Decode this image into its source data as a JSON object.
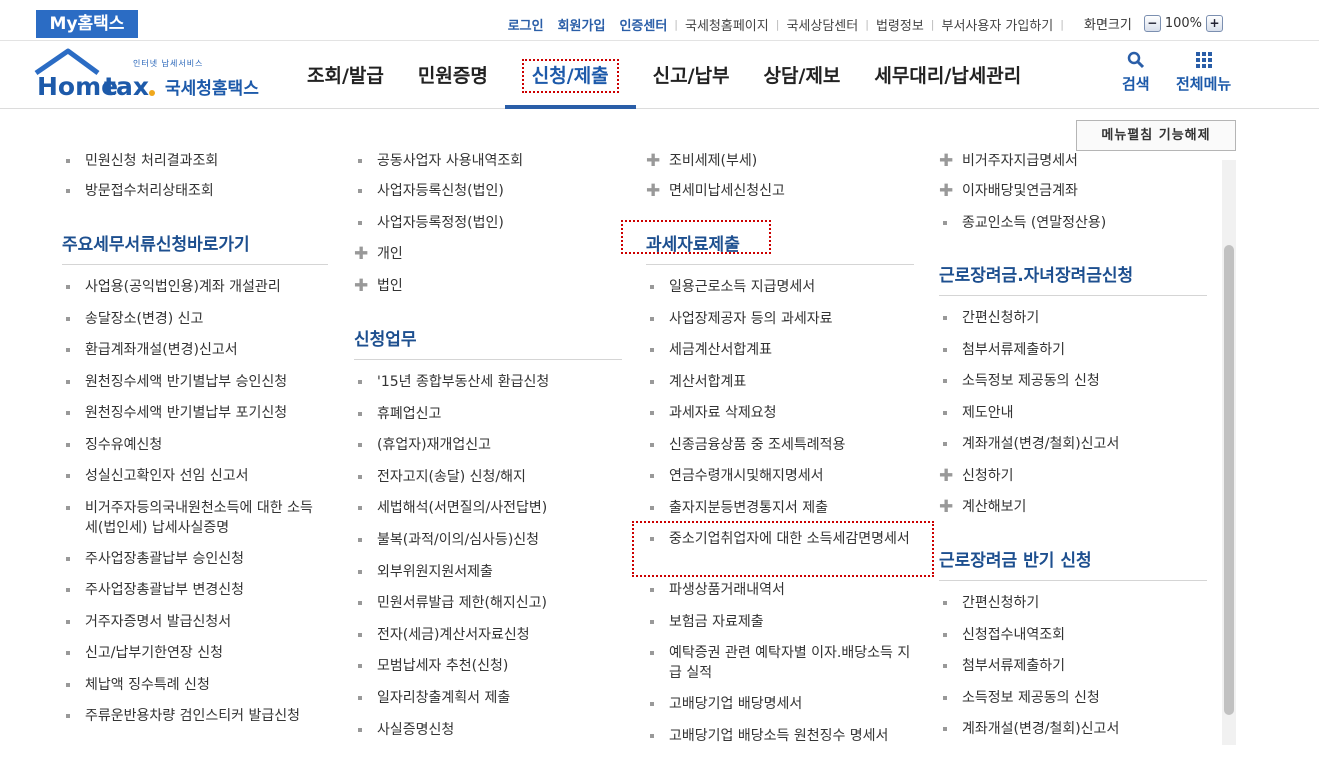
{
  "topbar": {
    "brand": "My홈택스",
    "links": [
      "로그인",
      "회원가입",
      "인증센터"
    ],
    "plain_links": [
      "국세청홈페이지",
      "국세상담센터",
      "법령정보",
      "부서사용자 가입하기"
    ],
    "zoom_label": "화면크기",
    "zoom_value": "100%",
    "zoom_minus": "−",
    "zoom_plus": "+"
  },
  "header": {
    "logo_sub": "인터넷 납세서비스",
    "logo_en": "Hometax.",
    "logo_ko": "국세청홈택스",
    "nav": [
      "조회/발급",
      "민원증명",
      "신청/제출",
      "신고/납부",
      "상담/제보",
      "세무대리/납세관리"
    ],
    "active_nav_index": 2,
    "search_label": "검색",
    "allmenu_label": "전체메뉴"
  },
  "expand_button": "메뉴펼침 기능해제",
  "col1": {
    "top_items": [
      "민원신청 처리결과조회",
      "방문접수처리상태조회"
    ],
    "section_title": "주요세무서류신청바로가기",
    "items": [
      "사업용(공익법인용)계좌 개설관리",
      "송달장소(변경) 신고",
      "환급계좌개설(변경)신고서",
      "원천징수세액 반기별납부 승인신청",
      "원천징수세액 반기별납부 포기신청",
      "징수유예신청",
      "성실신고확인자 선임 신고서",
      "비거주자등의국내원천소득에 대한 소득세(법인세) 납세사실증명",
      "주사업장총괄납부 승인신청",
      "주사업장총괄납부 변경신청",
      "거주자증명서 발급신청서",
      "신고/납부기한연장 신청",
      "체납액 징수특례 신청",
      "주류운반용차량 검인스티커 발급신청"
    ]
  },
  "col2": {
    "top_items": [
      {
        "t": "공동사업자 사용내역조회",
        "k": "sq"
      },
      {
        "t": "사업자등록신청(법인)",
        "k": "sq"
      },
      {
        "t": "사업자등록정정(법인)",
        "k": "sq"
      },
      {
        "t": "개인",
        "k": "plus"
      },
      {
        "t": "법인",
        "k": "plus"
      }
    ],
    "section_title": "신청업무",
    "items": [
      "'15년 종합부동산세 환급신청",
      "휴폐업신고",
      "(휴업자)재개업신고",
      "전자고지(송달) 신청/해지",
      "세법해석(서면질의/사전답변)",
      "불복(과적/이의/심사등)신청",
      "외부위원지원서제출",
      "민원서류발급 제한(해지신고)",
      "전자(세금)계산서자료신청",
      "모범납세자 추천(신청)",
      "일자리창출계획서 제출",
      "사실증명신청"
    ]
  },
  "col3": {
    "top_items": [
      {
        "t": "조비세제(부세)",
        "k": "plus"
      },
      {
        "t": "면세미납세신청신고",
        "k": "plus"
      }
    ],
    "section_title": "과세자료제출",
    "items": [
      "일용근로소득 지급명세서",
      "사업장제공자 등의 과세자료",
      "세금계산서합계표",
      "계산서합계표",
      "과세자료 삭제요청",
      "신종금융상품 중 조세특례적용",
      "연금수령개시및해지명세서",
      "출자지분등변경통지서 제출",
      "중소기업취업자에 대한 소득세감면명세서",
      "파생상품거래내역서",
      "보험금 자료제출",
      "예탁증권 관련 예탁자별 이자.배당소득 지급 실적",
      "고배당기업 배당명세서",
      "고배당기업 배당소득 원천징수 명세서"
    ]
  },
  "col4": {
    "top_items": [
      {
        "t": "비거주자지급명세서",
        "k": "plus"
      },
      {
        "t": "이자배당및연금계좌",
        "k": "plus"
      },
      {
        "t": "종교인소득 (연말정산용)",
        "k": "sq"
      }
    ],
    "section1_title": "근로장려금.자녀장려금신청",
    "section1_items": [
      {
        "t": "간편신청하기",
        "k": "sq"
      },
      {
        "t": "첨부서류제출하기",
        "k": "sq"
      },
      {
        "t": "소득정보 제공동의 신청",
        "k": "sq"
      },
      {
        "t": "제도안내",
        "k": "sq"
      },
      {
        "t": "계좌개설(변경/철회)신고서",
        "k": "sq"
      },
      {
        "t": "신청하기",
        "k": "plus"
      },
      {
        "t": "계산해보기",
        "k": "plus"
      }
    ],
    "section2_title": "근로장려금 반기 신청",
    "section2_items": [
      "간편신청하기",
      "신청접수내역조회",
      "첨부서류제출하기",
      "소득정보 제공동의 신청",
      "계좌개설(변경/철회)신고서"
    ]
  }
}
